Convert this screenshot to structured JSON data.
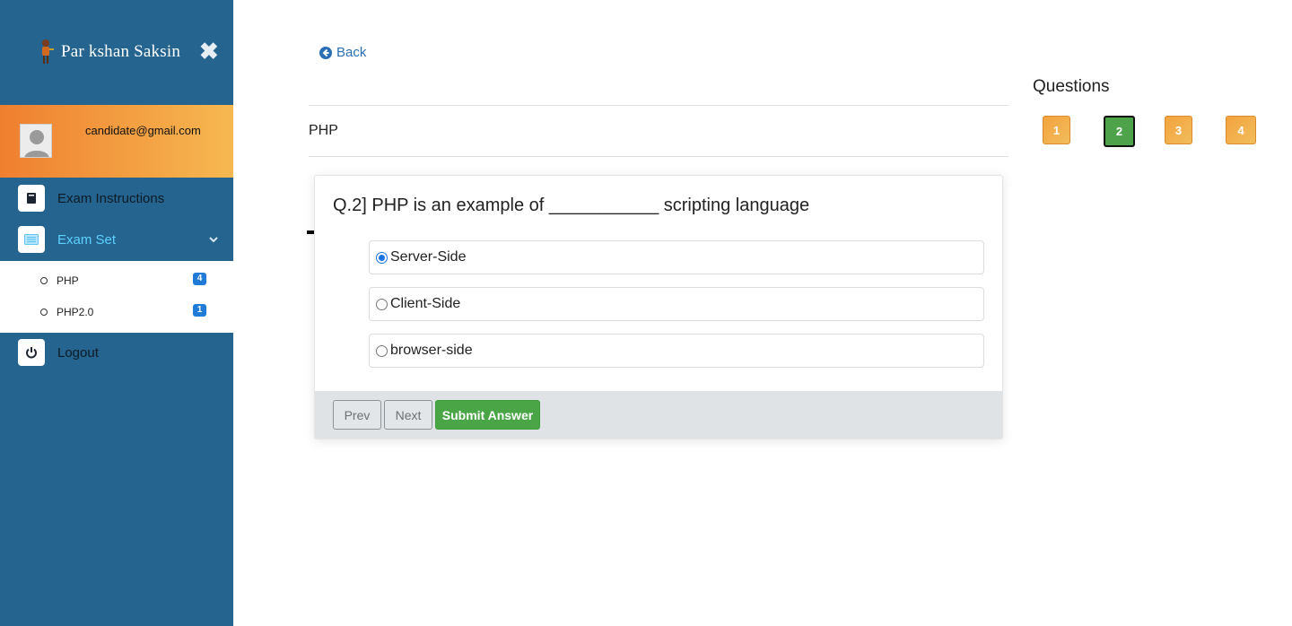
{
  "sidebar": {
    "brand_text": "Par kshan Saksin",
    "close_symbol": "✖",
    "user_email": "candidate@gmail.com",
    "menu": [
      {
        "label": "Exam Instructions",
        "icon": "book-icon"
      },
      {
        "label": "Exam Set",
        "icon": "list-icon",
        "active": true
      },
      {
        "label": "Logout",
        "icon": "power-icon"
      }
    ],
    "submenu": [
      {
        "label": "PHP",
        "count": "4"
      },
      {
        "label": "PHP2.0",
        "count": "1"
      }
    ]
  },
  "main": {
    "back_label": "Back",
    "subject": "PHP",
    "question_text": "Q.2] PHP is an example of ___________ scripting language",
    "options": [
      {
        "label": "Server-Side",
        "selected": true
      },
      {
        "label": "Client-Side",
        "selected": false
      },
      {
        "label": "browser-side",
        "selected": false
      }
    ],
    "buttons": {
      "prev": "Prev",
      "next": "Next",
      "submit": "Submit Answer"
    }
  },
  "questions_panel": {
    "title": "Questions",
    "items": [
      {
        "label": "1",
        "state": "pending"
      },
      {
        "label": "2",
        "state": "current"
      },
      {
        "label": "3",
        "state": "pending"
      },
      {
        "label": "4",
        "state": "pending"
      }
    ]
  },
  "colors": {
    "sidebar": "#24648f",
    "user_panel_from": "#ef7f2f",
    "user_panel_to": "#f6b851",
    "active_menu": "#5ed1ff",
    "badge": "#1f7ad8",
    "submit": "#4aa547",
    "pending": "#f3a33e",
    "current": "#4ea34a",
    "link": "#2a6fb5"
  }
}
